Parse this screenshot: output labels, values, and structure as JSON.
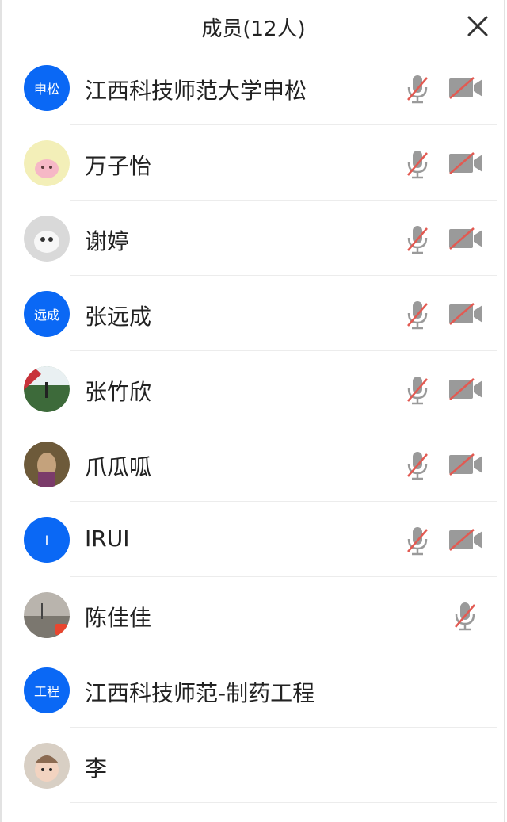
{
  "header": {
    "title": "成员(12人)"
  },
  "members": [
    {
      "name": "江西科技师范大学申松",
      "avatar_text": "申松",
      "avatar_type": "text",
      "mic_muted": true,
      "cam_off": true
    },
    {
      "name": "万子怡",
      "avatar_type": "photo",
      "avatar_theme": "pig",
      "mic_muted": true,
      "cam_off": true
    },
    {
      "name": "谢婷",
      "avatar_type": "photo",
      "avatar_theme": "dog",
      "mic_muted": true,
      "cam_off": true
    },
    {
      "name": "张远成",
      "avatar_text": "远成",
      "avatar_type": "text",
      "mic_muted": true,
      "cam_off": true
    },
    {
      "name": "张竹欣",
      "avatar_type": "photo",
      "avatar_theme": "landscape",
      "mic_muted": true,
      "cam_off": true
    },
    {
      "name": "爪瓜呱",
      "avatar_type": "photo",
      "avatar_theme": "portrait",
      "mic_muted": true,
      "cam_off": true
    },
    {
      "name": "IRUI",
      "avatar_text": "I",
      "avatar_type": "text",
      "mic_muted": true,
      "cam_off": true
    },
    {
      "name": "陈佳佳",
      "avatar_type": "photo",
      "avatar_theme": "sky",
      "mic_muted": true,
      "cam_off": false
    },
    {
      "name": "江西科技师范-制药工程",
      "avatar_text": "工程",
      "avatar_type": "text",
      "mic_muted": false,
      "cam_off": false
    },
    {
      "name": "李",
      "avatar_type": "photo",
      "avatar_theme": "baby",
      "mic_muted": false,
      "cam_off": false
    }
  ],
  "colors": {
    "accent": "#0a68f5",
    "muted_slash": "#e25a52",
    "icon_gray": "#9a9a9a"
  },
  "icons": {
    "close": "close-icon",
    "mic": "mic-muted-icon",
    "cam": "camera-off-icon"
  }
}
